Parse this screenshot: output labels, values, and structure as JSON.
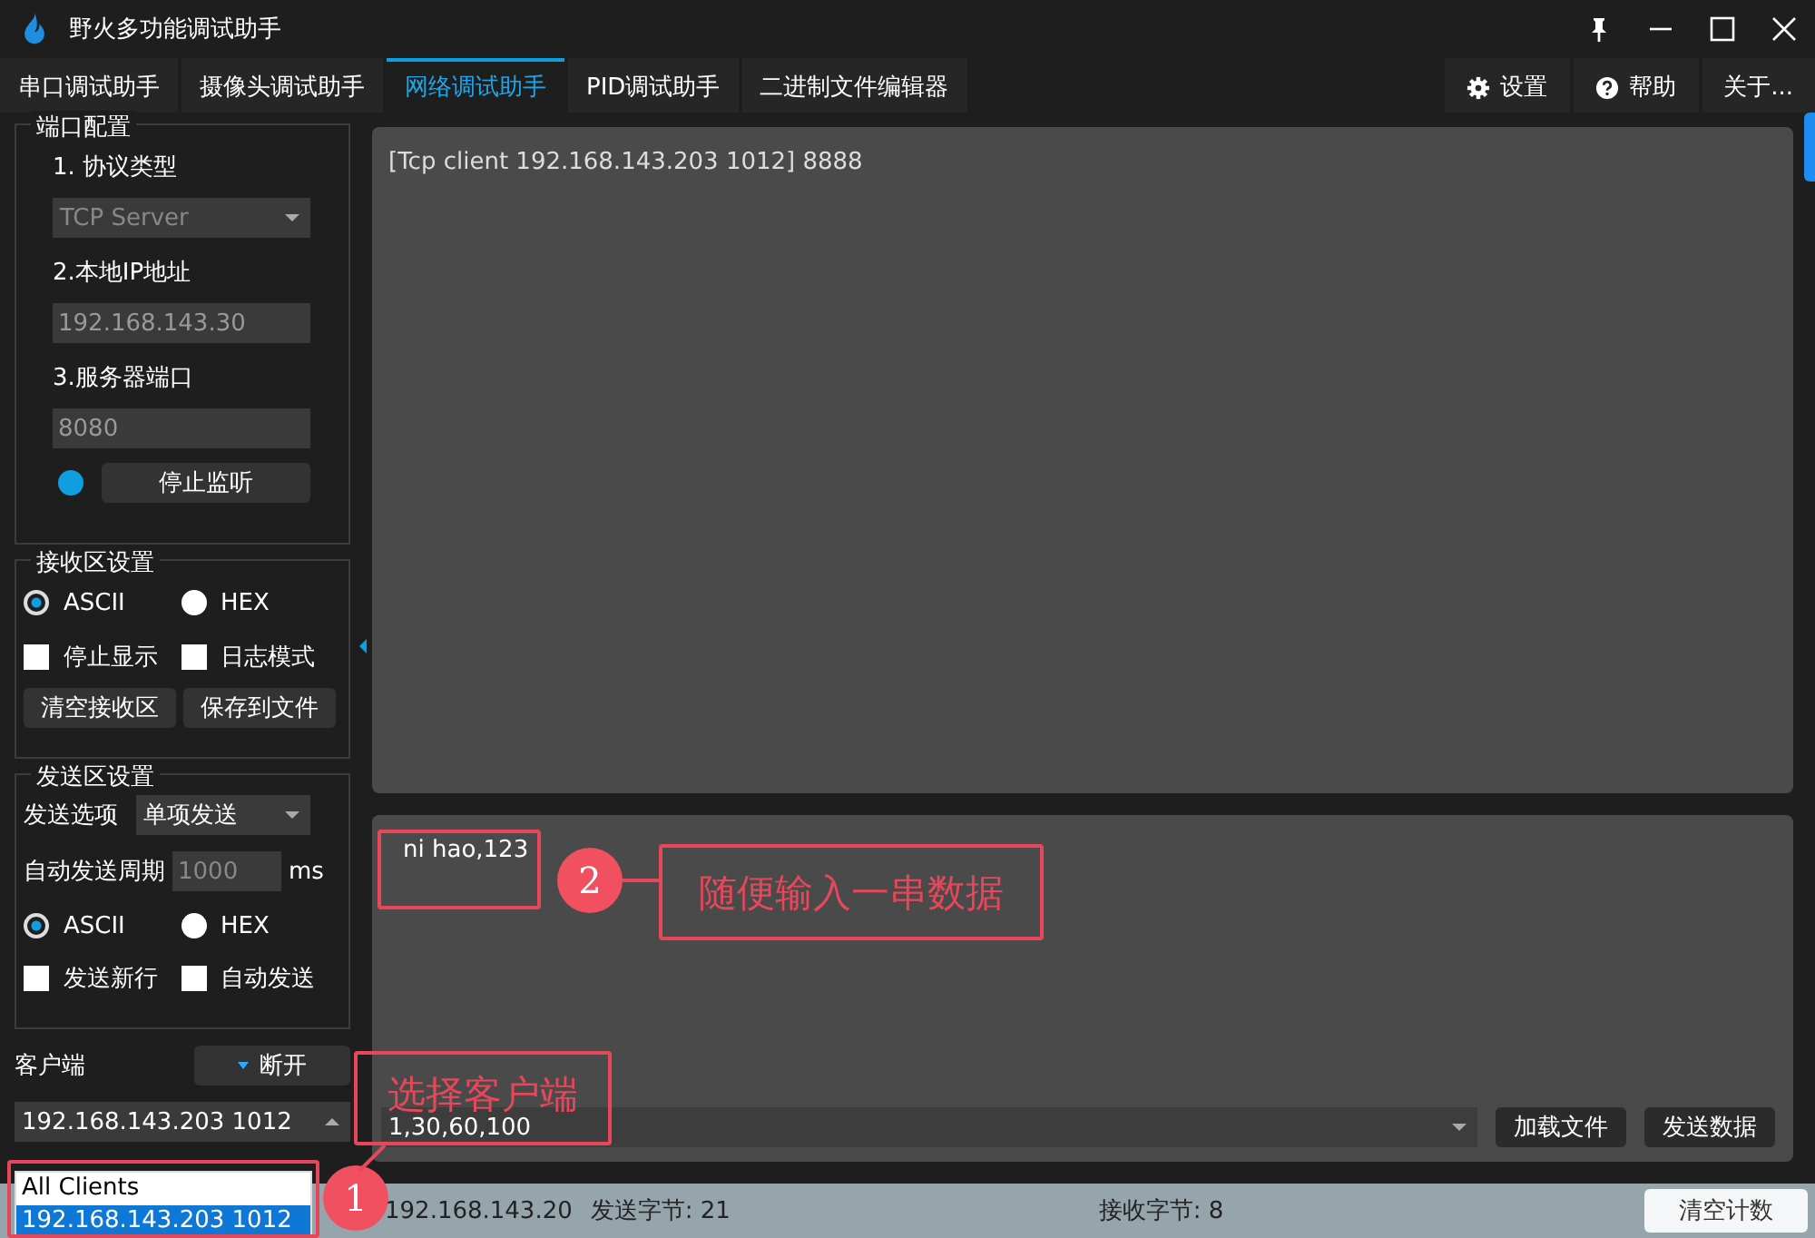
{
  "window": {
    "title": "野火多功能调试助手"
  },
  "tabs": [
    {
      "label": "串口调试助手",
      "selected": false
    },
    {
      "label": "摄像头调试助手",
      "selected": false
    },
    {
      "label": "网络调试助手",
      "selected": true
    },
    {
      "label": "PID调试助手",
      "selected": false
    },
    {
      "label": "二进制文件编辑器",
      "selected": false
    }
  ],
  "menu_buttons": [
    {
      "label": "设置",
      "kind": "gear"
    },
    {
      "label": "帮助",
      "kind": "help"
    },
    {
      "label": "关于...",
      "kind": "none"
    }
  ],
  "port_config": {
    "title": "端口配置",
    "protocol_label": "1. 协议类型",
    "protocol": "TCP Server",
    "ip_label": "2.本地IP地址",
    "ip": "192.168.143.30",
    "port_label": "3.服务器端口",
    "port": "8080",
    "listening": true,
    "listen_button": "停止监听"
  },
  "receive_settings": {
    "title": "接收区设置",
    "modes": [
      {
        "label": "ASCII",
        "selected": true
      },
      {
        "label": "HEX",
        "selected": false
      }
    ],
    "options": [
      {
        "label": "停止显示",
        "checked": false
      },
      {
        "label": "日志模式",
        "checked": false
      }
    ],
    "buttons": [
      "清空接收区",
      "保存到文件"
    ]
  },
  "send_settings": {
    "title": "发送区设置",
    "option_label": "发送选项",
    "option": "单项发送",
    "period_label": "自动发送周期",
    "period": "1000",
    "period_unit": "ms",
    "modes": [
      {
        "label": "ASCII",
        "selected": true
      },
      {
        "label": "HEX",
        "selected": false
      }
    ],
    "options": [
      {
        "label": "发送新行",
        "checked": false
      },
      {
        "label": "自动发送",
        "checked": false
      }
    ]
  },
  "clients": {
    "label": "客户端",
    "disconnect_button": "断开",
    "current": "192.168.143.203 1012",
    "dropdown": [
      {
        "label": "All Clients",
        "selected": false
      },
      {
        "label": "192.168.143.203 1012",
        "selected": true
      }
    ]
  },
  "receive_area": {
    "text": "[Tcp client 192.168.143.203 1012] 8888"
  },
  "send_area": {
    "text": "ni hao,123",
    "history": "1,30,60,100",
    "buttons": [
      "加载文件",
      "发送数据"
    ]
  },
  "status_bar": {
    "client": "192.168.143.20",
    "sent": "发送字节: 21",
    "received": "接收字节: 8",
    "reset_button": "清空计数"
  },
  "annotations": [
    {
      "number": "1",
      "text": "选择客户端"
    },
    {
      "number": "2",
      "text": "随便输入一串数据"
    }
  ]
}
